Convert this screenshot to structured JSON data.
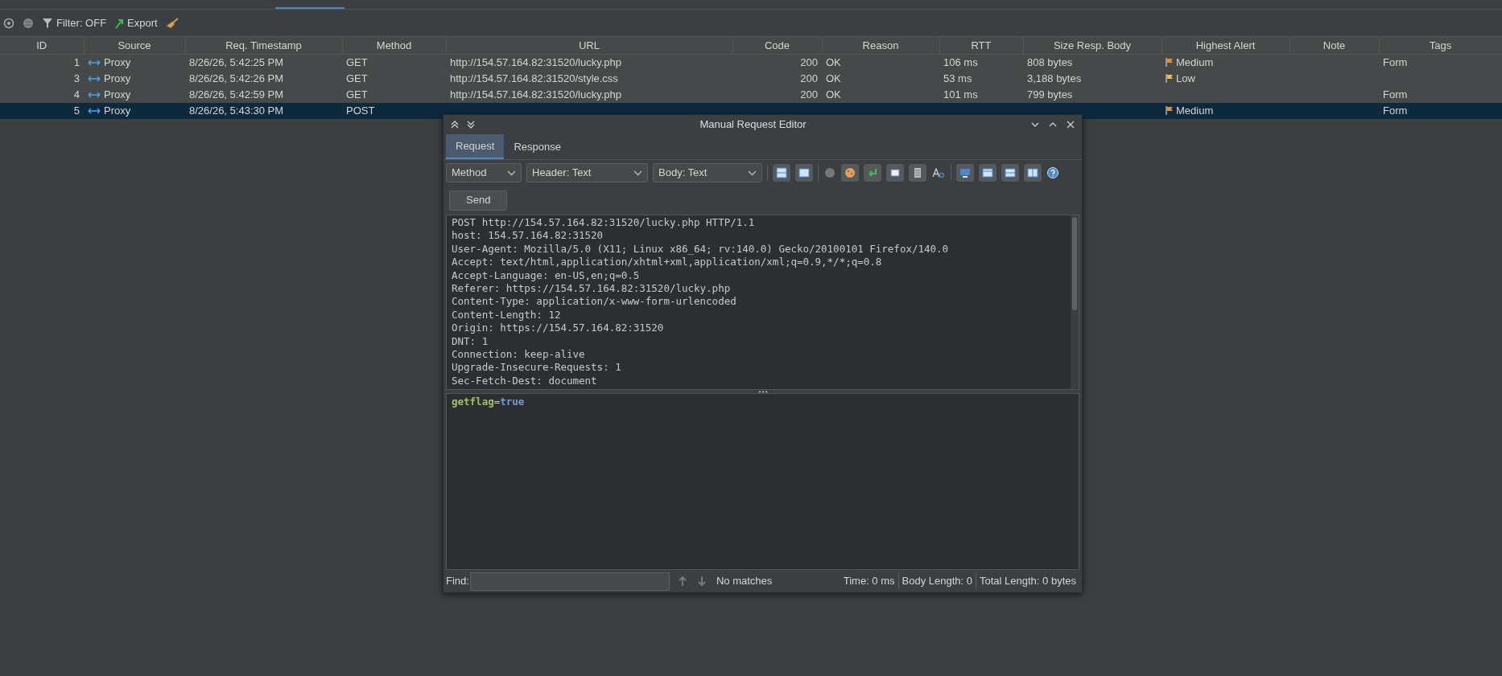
{
  "toolbar": {
    "filter": "Filter: OFF",
    "export": "Export"
  },
  "table": {
    "columns": [
      "ID",
      "Source",
      "Req. Timestamp",
      "Method",
      "URL",
      "Code",
      "Reason",
      "RTT",
      "Size Resp. Body",
      "Highest Alert",
      "Note",
      "Tags"
    ],
    "rows": [
      {
        "selected": false,
        "id": "1",
        "source": "Proxy",
        "timestamp": "8/26/26, 5:42:25 PM",
        "method": "GET",
        "url": "http://154.57.164.82:31520/lucky.php",
        "code": "200",
        "reason": "OK",
        "rtt": "106 ms",
        "size": "808 bytes",
        "alert": {
          "label": "Medium",
          "color": "#f08a24"
        },
        "tags": "Form"
      },
      {
        "selected": false,
        "id": "3",
        "source": "Proxy",
        "timestamp": "8/26/26, 5:42:26 PM",
        "method": "GET",
        "url": "http://154.57.164.82:31520/style.css",
        "code": "200",
        "reason": "OK",
        "rtt": "53 ms",
        "size": "3,188 bytes",
        "alert": {
          "label": "Low",
          "color": "#f2c230"
        }
      },
      {
        "selected": false,
        "id": "4",
        "source": "Proxy",
        "timestamp": "8/26/26, 5:42:59 PM",
        "method": "GET",
        "url": "http://154.57.164.82:31520/lucky.php",
        "code": "200",
        "reason": "OK",
        "rtt": "101 ms",
        "size": "799 bytes",
        "tags": "Form"
      },
      {
        "selected": true,
        "id": "5",
        "source": "Proxy",
        "timestamp": "8/26/26, 5:43:30 PM",
        "method": "POST",
        "alert": {
          "label": "Medium",
          "color": "#f08a24"
        },
        "tags": "Form"
      }
    ]
  },
  "dialog": {
    "title": "Manual Request Editor",
    "tabs": [
      {
        "label": "Request",
        "selected": true
      },
      {
        "label": "Response",
        "selected": false
      }
    ],
    "dropdowns": [
      "Method",
      "Header: Text",
      "Body: Text"
    ],
    "send": "Send",
    "header_lines": [
      "POST http://154.57.164.82:31520/lucky.php HTTP/1.1",
      "host: 154.57.164.82:31520",
      "User-Agent: Mozilla/5.0 (X11; Linux x86_64; rv:140.0) Gecko/20100101 Firefox/140.0",
      "Accept: text/html,application/xhtml+xml,application/xml;q=0.9,*/*;q=0.8",
      "Accept-Language: en-US,en;q=0.5",
      "Referer: https://154.57.164.82:31520/lucky.php",
      "Content-Type: application/x-www-form-urlencoded",
      "Content-Length: 12",
      "Origin: https://154.57.164.82:31520",
      "DNT: 1",
      "Connection: keep-alive",
      "Upgrade-Insecure-Requests: 1",
      "Sec-Fetch-Dest: document"
    ],
    "body": [
      {
        "kind": "name",
        "text": "getflag"
      },
      {
        "kind": "operator",
        "text": "="
      },
      {
        "kind": "value",
        "text": "true"
      }
    ],
    "find": {
      "label": "Find:",
      "status": "No matches",
      "stats": [
        "Time: 0 ms",
        "Body Length: 0",
        "Total Length: 0 bytes"
      ]
    }
  }
}
